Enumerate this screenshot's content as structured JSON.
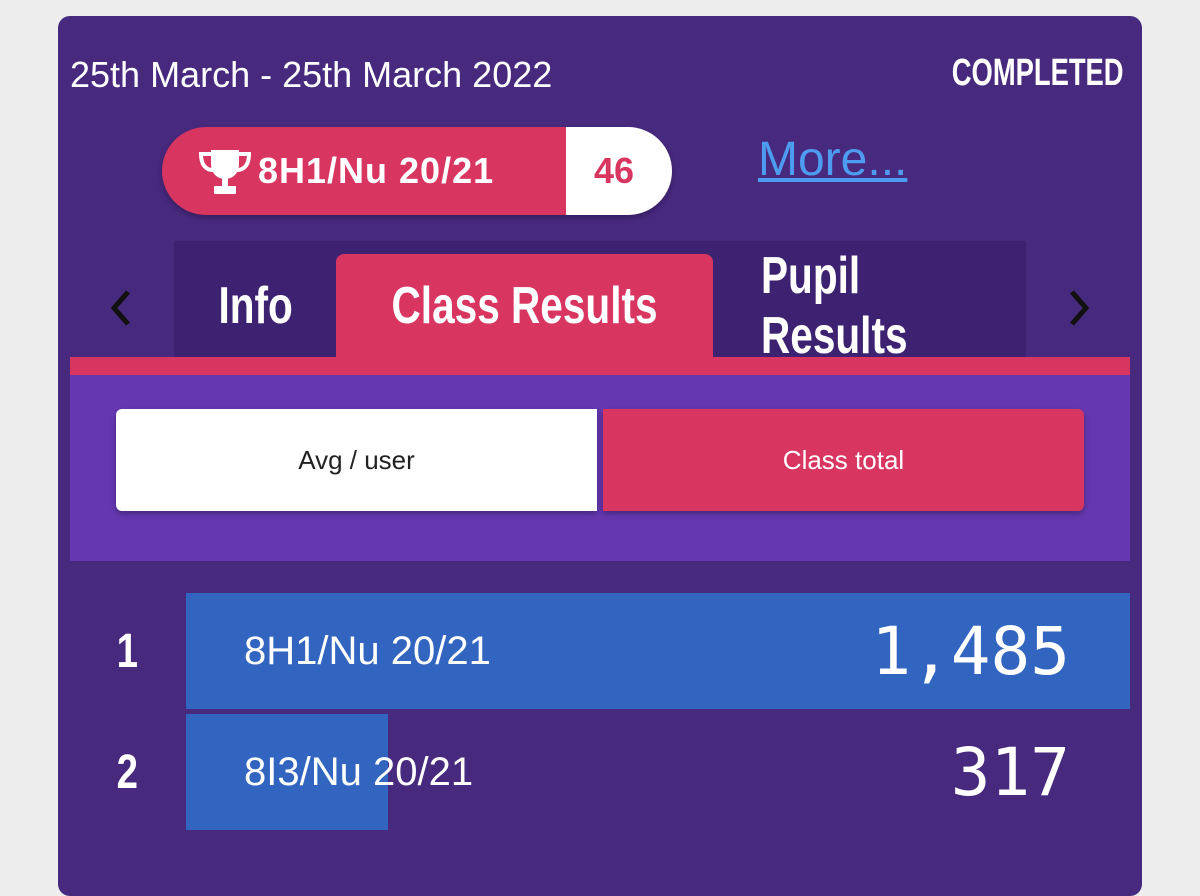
{
  "header": {
    "date_range": "25th March - 25th March 2022",
    "status": "COMPLETED"
  },
  "badge": {
    "icon": "trophy-icon",
    "label": "8H1/Nu 20/21",
    "count": "46"
  },
  "more_link": "More...",
  "tabs": [
    {
      "label": "Info",
      "active": false
    },
    {
      "label": "Class Results",
      "active": true
    },
    {
      "label": "Pupil Results",
      "active": false
    }
  ],
  "toggle": {
    "options": [
      "Avg / user",
      "Class total"
    ],
    "selected": "Class total"
  },
  "results": [
    {
      "rank": "1",
      "class": "8H1/Nu 20/21",
      "value": "1,485",
      "amount": 1485
    },
    {
      "rank": "2",
      "class": "8I3/Nu 20/21",
      "value": "317",
      "amount": 317
    }
  ],
  "colors": {
    "card_bg": "#47297e",
    "accent": "#d83561",
    "panel": "#6538b0",
    "bar": "#3165c0",
    "link": "#4d9cf0"
  }
}
